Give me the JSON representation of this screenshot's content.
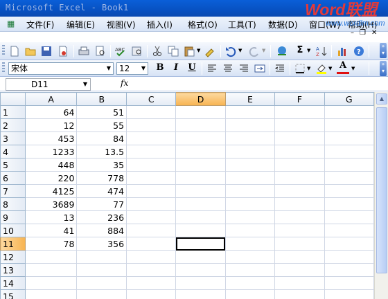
{
  "window": {
    "title": "Microsoft Excel - Book1"
  },
  "watermark": {
    "brand_a": "Word",
    "brand_b": "联盟",
    "url": "www.wordlm.com"
  },
  "menu": {
    "items": [
      "文件(F)",
      "编辑(E)",
      "视图(V)",
      "插入(I)",
      "格式(O)",
      "工具(T)",
      "数据(D)",
      "窗口(W)",
      "帮助(H)"
    ]
  },
  "toolbar_format": {
    "font_name": "宋体",
    "font_size": "12",
    "bold": "B",
    "italic": "I",
    "underline": "U",
    "font_color_letter": "A"
  },
  "toolbar_standard": {
    "sigma": "Σ"
  },
  "formula_bar": {
    "name_box": "D11",
    "fx_label": "fx",
    "formula": ""
  },
  "sheet": {
    "active_cell": "D11",
    "columns": [
      "A",
      "B",
      "C",
      "D",
      "E",
      "F",
      "G"
    ],
    "rows": [
      {
        "n": "1",
        "a": "64",
        "b": "51"
      },
      {
        "n": "2",
        "a": "12",
        "b": "55"
      },
      {
        "n": "3",
        "a": "453",
        "b": "84"
      },
      {
        "n": "4",
        "a": "1233",
        "b": "13.5"
      },
      {
        "n": "5",
        "a": "448",
        "b": "35"
      },
      {
        "n": "6",
        "a": "220",
        "b": "778"
      },
      {
        "n": "7",
        "a": "4125",
        "b": "474"
      },
      {
        "n": "8",
        "a": "3689",
        "b": "77"
      },
      {
        "n": "9",
        "a": "13",
        "b": "236"
      },
      {
        "n": "10",
        "a": "41",
        "b": "884"
      },
      {
        "n": "11",
        "a": "78",
        "b": "356"
      },
      {
        "n": "12",
        "a": "",
        "b": ""
      },
      {
        "n": "13",
        "a": "",
        "b": ""
      },
      {
        "n": "14",
        "a": "",
        "b": ""
      },
      {
        "n": "15",
        "a": "",
        "b": ""
      }
    ]
  },
  "colors": {
    "title_bar": "#0a5fd8",
    "selected_header": "#f8b451",
    "grid": "#d0d7e5"
  }
}
